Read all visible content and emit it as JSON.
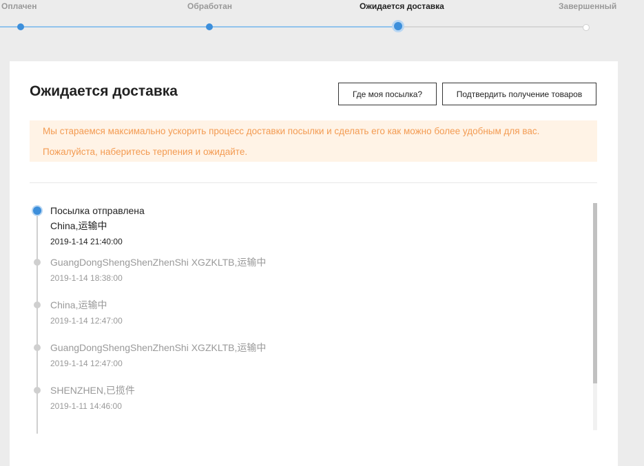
{
  "stepper": {
    "steps": [
      {
        "label": "Оплачен",
        "state": "done"
      },
      {
        "label": "Обработан",
        "state": "done"
      },
      {
        "label": "Ожидается доставка",
        "state": "current"
      },
      {
        "label": "Завершенный",
        "state": "todo"
      }
    ]
  },
  "card": {
    "title": "Ожидается доставка",
    "where_button": "Где моя посылка?",
    "confirm_button": "Подтвердить получение товаров",
    "notice_line1": "Мы стараемся максимально ускорить процесс доставки посылки и сделать его как можно более удобным для вас.",
    "notice_line2": "Пожалуйста, наберитесь терпения и ожидайте."
  },
  "timeline": [
    {
      "status": "Посылка отправлена",
      "location": "China,运输中",
      "time": "2019-1-14 21:40:00"
    },
    {
      "location": "GuangDongShengShenZhenShi XGZKLTB,运输中",
      "time": "2019-1-14 18:38:00"
    },
    {
      "location": "China,运输中",
      "time": "2019-1-14 12:47:00"
    },
    {
      "location": "GuangDongShengShenZhenShi XGZKLTB,运输中",
      "time": "2019-1-14 12:47:00"
    },
    {
      "location": "SHENZHEN,已揽件",
      "time": "2019-1-11 14:46:00"
    }
  ],
  "colors": {
    "accent": "#3d8fdb",
    "notice_bg": "#fff3e6",
    "notice_text": "#f39b52"
  }
}
